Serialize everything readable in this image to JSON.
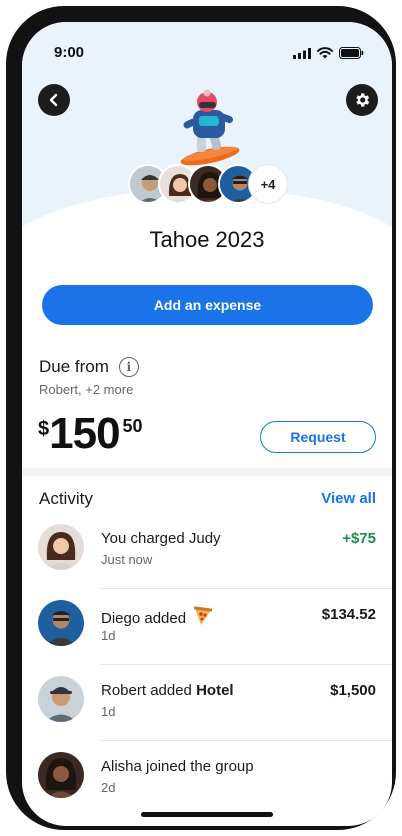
{
  "status": {
    "time": "9:00"
  },
  "group": {
    "name": "Tahoe 2023",
    "extra_members": "+4"
  },
  "actions": {
    "add_expense": "Add an expense",
    "request": "Request"
  },
  "due": {
    "title": "Due from",
    "subtitle": "Robert, +2 more",
    "currency": "$",
    "amount_whole": "150",
    "amount_cents": "50"
  },
  "activity": {
    "title": "Activity",
    "view_all": "View all",
    "items": [
      {
        "name": "You charged Judy",
        "time": "Just now",
        "amount": "+$75"
      },
      {
        "name": "Diego added",
        "time": "1d",
        "amount": "$134.52",
        "icon": "pizza-icon"
      },
      {
        "name_prefix": "Robert added",
        "name_bold": "Hotel",
        "time": "1d",
        "amount": "$1,500"
      },
      {
        "name": "Alisha joined the group",
        "time": "2d"
      }
    ]
  },
  "colors": {
    "accent": "#1a73e8",
    "positive": "#1e8a4c",
    "hero_bg": "#eaf3fb"
  }
}
